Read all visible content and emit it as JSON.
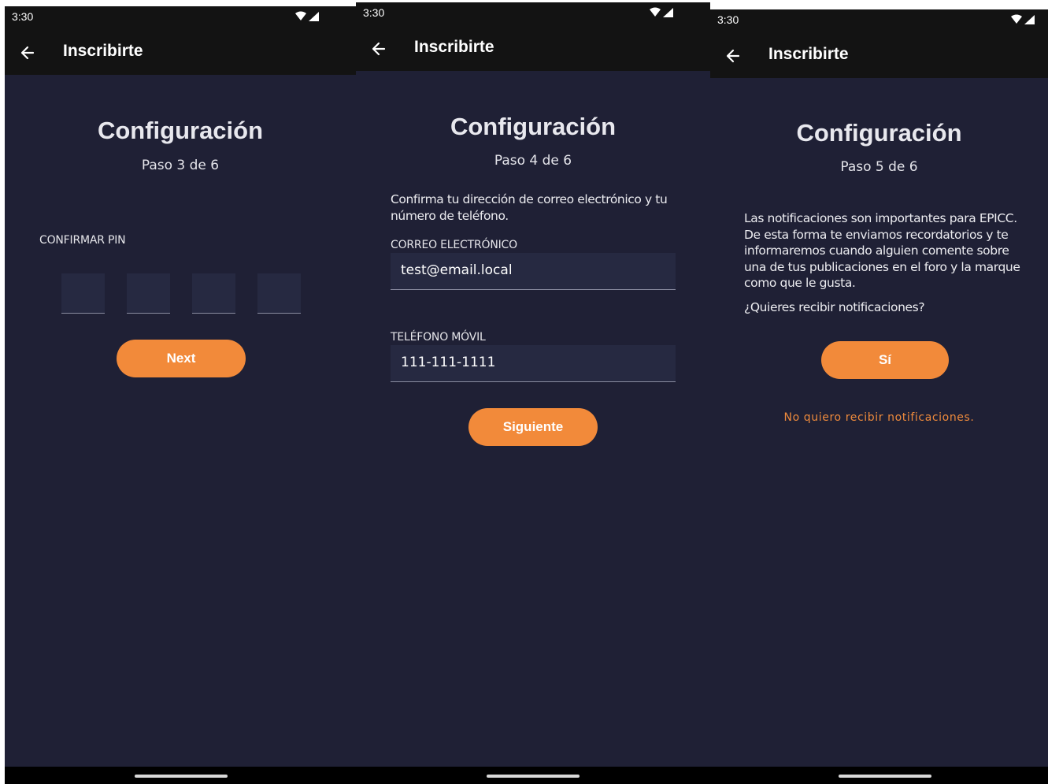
{
  "screens": [
    {
      "status_time": "3:30",
      "appbar_title": "Inscribirte",
      "title": "Configuración",
      "step": "Paso 3 de 6",
      "pin_label": "CONFIRMAR PIN",
      "button_label": "Next"
    },
    {
      "status_time": "3:30",
      "appbar_title": "Inscribirte",
      "title": "Configuración",
      "step": "Paso 4 de 6",
      "instruction": "Confirma tu dirección de correo electrónico y tu número de teléfono.",
      "email_label": "CORREO ELECTRÓNICO",
      "email_value": "test@email.local",
      "phone_label": "TELÉFONO MÓVIL",
      "phone_value": "111-111-1111",
      "button_label": "Siguiente"
    },
    {
      "status_time": "3:30",
      "appbar_title": "Inscribirte",
      "title": "Configuración",
      "step": "Paso 5 de 6",
      "description": "Las notificaciones son importantes para EPICC. De esta forma te enviamos recordatorios y te informaremos cuando alguien comente sobre una de tus publicaciones en el foro y la marque como que le gusta.",
      "question": "¿Quieres recibir notificaciones?",
      "button_label": "Sí",
      "decline_link": "No quiero recibir notificaciones."
    }
  ],
  "icons": {
    "back": "arrow-left-icon",
    "wifi": "wifi-icon",
    "signal": "cell-signal-icon"
  },
  "colors": {
    "background": "#1f2035",
    "bar": "#131313",
    "accent": "#f28a3a",
    "field": "#262941"
  }
}
